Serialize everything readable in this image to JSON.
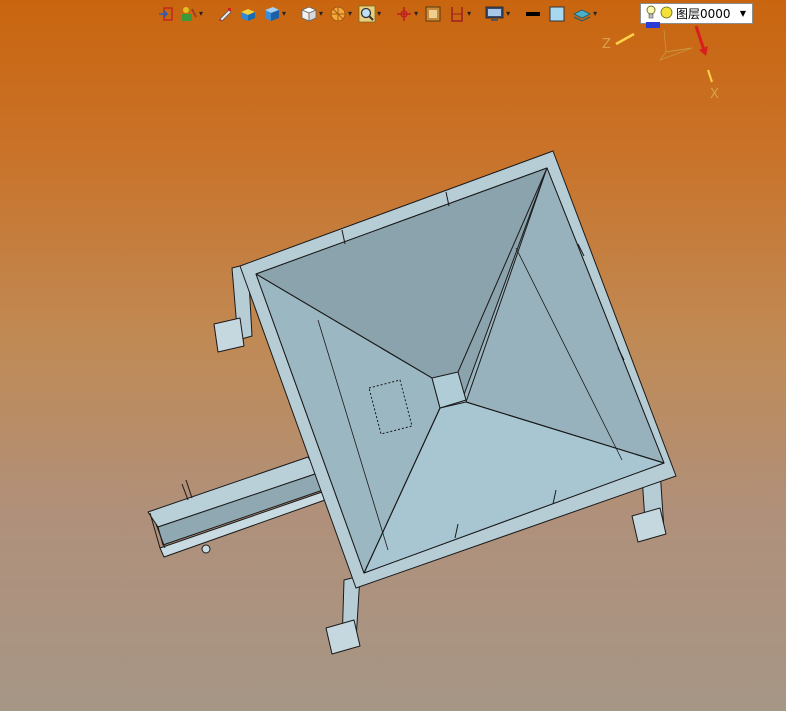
{
  "toolbar": {
    "buttons": [
      {
        "icon": "exit-sketch-icon",
        "has_dropdown": false
      },
      {
        "icon": "sketch-tools-icon",
        "has_dropdown": true
      },
      {
        "icon": "pen-icon",
        "has_dropdown": false
      },
      {
        "icon": "solid-box-icon",
        "has_dropdown": false
      },
      {
        "icon": "view-cube-icon",
        "has_dropdown": true
      },
      {
        "icon": "wire-cube-icon",
        "has_dropdown": true
      },
      {
        "icon": "section-view-icon",
        "has_dropdown": true
      },
      {
        "icon": "zoom-icon",
        "has_dropdown": true
      },
      {
        "icon": "triad-move-icon",
        "has_dropdown": true
      },
      {
        "icon": "render-mode-icon",
        "has_dropdown": false
      },
      {
        "icon": "measure-icon",
        "has_dropdown": true
      },
      {
        "icon": "display-icon",
        "has_dropdown": true
      },
      {
        "icon": "line-style-icon",
        "has_dropdown": false
      },
      {
        "icon": "color-swatch-icon",
        "has_dropdown": false
      },
      {
        "icon": "layer-manager-icon",
        "has_dropdown": true
      }
    ],
    "layer": {
      "value": "图层0000",
      "icons": [
        "lightbulb-icon",
        "layer-color-icon"
      ]
    }
  },
  "triad": {
    "labels": {
      "z": "Z",
      "x": "X"
    },
    "colors": {
      "z": "#ffd24a",
      "x": "#d81e1e",
      "y": "#2a3bd6"
    }
  },
  "colors": {
    "background_top": "#c9650f",
    "background_bottom": "#a69686",
    "hopper_face_light": "#a7c3ce",
    "hopper_face_dark": "#8ba4ad",
    "frame": "#b7cdd6"
  }
}
